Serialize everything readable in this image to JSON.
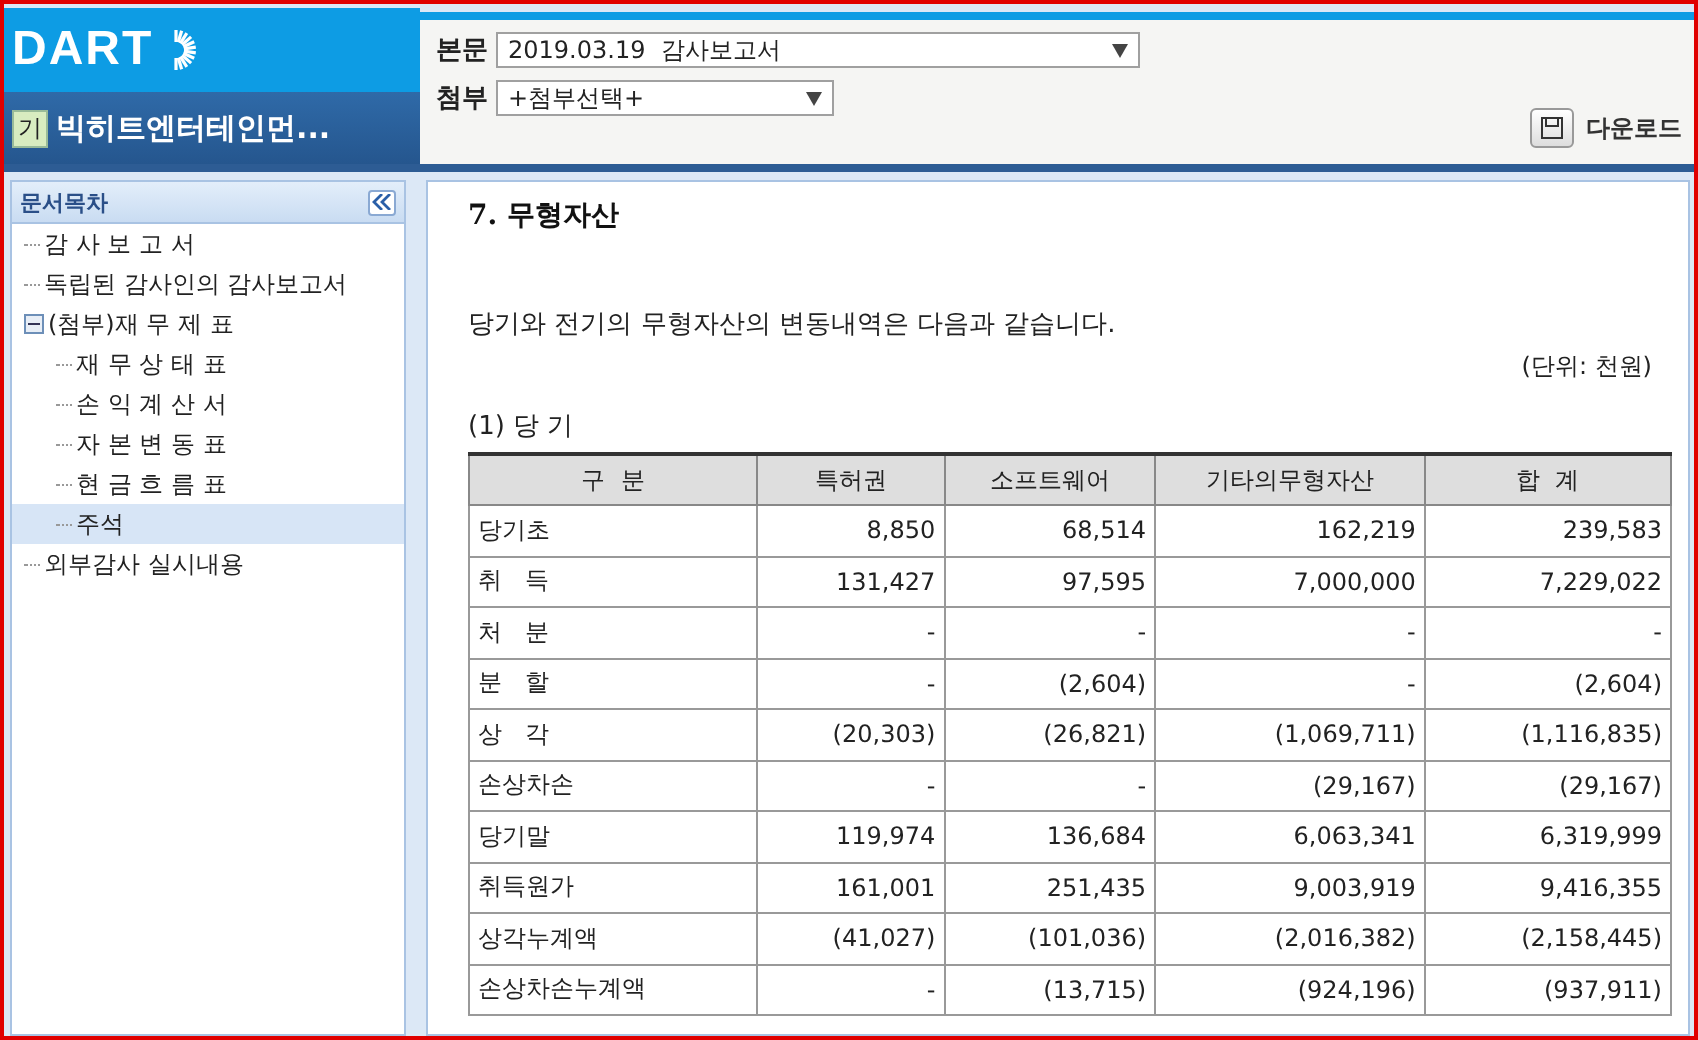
{
  "header": {
    "logo": "DART",
    "company_badge": "기",
    "company": "빅히트엔터테인먼...",
    "main_doc": {
      "label": "본문",
      "value": "2019.03.19  감사보고서"
    },
    "attachment": {
      "label": "첨부",
      "value": "+첨부선택+"
    },
    "download": "다운로드"
  },
  "sidebar": {
    "title": "문서목차",
    "items": [
      {
        "label": "감 사 보 고 서",
        "selected": false
      },
      {
        "label": "독립된 감사인의 감사보고서",
        "selected": false
      },
      {
        "label": "(첨부)재 무 제 표",
        "selected": false,
        "expanded": true,
        "children": [
          {
            "label": "재 무 상 태 표",
            "selected": false
          },
          {
            "label": "손 익 계 산 서",
            "selected": false
          },
          {
            "label": "자 본 변 동 표",
            "selected": false
          },
          {
            "label": "현 금 흐 름 표",
            "selected": false
          },
          {
            "label": "주석",
            "selected": true
          }
        ]
      },
      {
        "label": "외부감사 실시내용",
        "selected": false
      }
    ]
  },
  "content": {
    "title": "7. 무형자산",
    "intro": "당기와 전기의 무형자산의 변동내역은 다음과 같습니다.",
    "unit": "(단위: 천원)",
    "subtitle": "(1) 당 기",
    "table": {
      "columns": [
        "구  분",
        "특허권",
        "소프트웨어",
        "기타의무형자산",
        "합  계"
      ],
      "rows": [
        [
          "당기초",
          "8,850",
          "68,514",
          "162,219",
          "239,583"
        ],
        [
          "취   득",
          "131,427",
          "97,595",
          "7,000,000",
          "7,229,022"
        ],
        [
          "처   분",
          "-",
          "-",
          "-",
          "-"
        ],
        [
          "분   할",
          "-",
          "(2,604)",
          "-",
          "(2,604)"
        ],
        [
          "상   각",
          "(20,303)",
          "(26,821)",
          "(1,069,711)",
          "(1,116,835)"
        ],
        [
          "손상차손",
          "-",
          "-",
          "(29,167)",
          "(29,167)"
        ],
        [
          "당기말",
          "119,974",
          "136,684",
          "6,063,341",
          "6,319,999"
        ],
        [
          "취득원가",
          "161,001",
          "251,435",
          "9,003,919",
          "9,416,355"
        ],
        [
          "상각누계액",
          "(41,027)",
          "(101,036)",
          "(2,016,382)",
          "(2,158,445)"
        ],
        [
          "손상차손누계액",
          "-",
          "(13,715)",
          "(924,196)",
          "(937,911)"
        ]
      ]
    }
  }
}
